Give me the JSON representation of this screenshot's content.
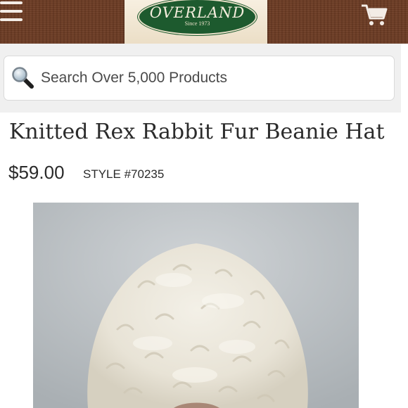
{
  "header": {
    "menu_icon": "hamburger-menu-icon",
    "cart_icon": "shopping-cart-icon",
    "logo": {
      "brand": "OVERLAND",
      "tagline": "Since 1973"
    },
    "colors": {
      "bar": "#6b3a22",
      "logo_green": "#1d5a2e"
    }
  },
  "search": {
    "placeholder": "Search Over 5,000 Products",
    "icon": "magnifier-icon"
  },
  "product": {
    "title": "Knitted Rex Rabbit Fur Beanie Hat",
    "price": "$59.00",
    "style": "STYLE #70235"
  }
}
